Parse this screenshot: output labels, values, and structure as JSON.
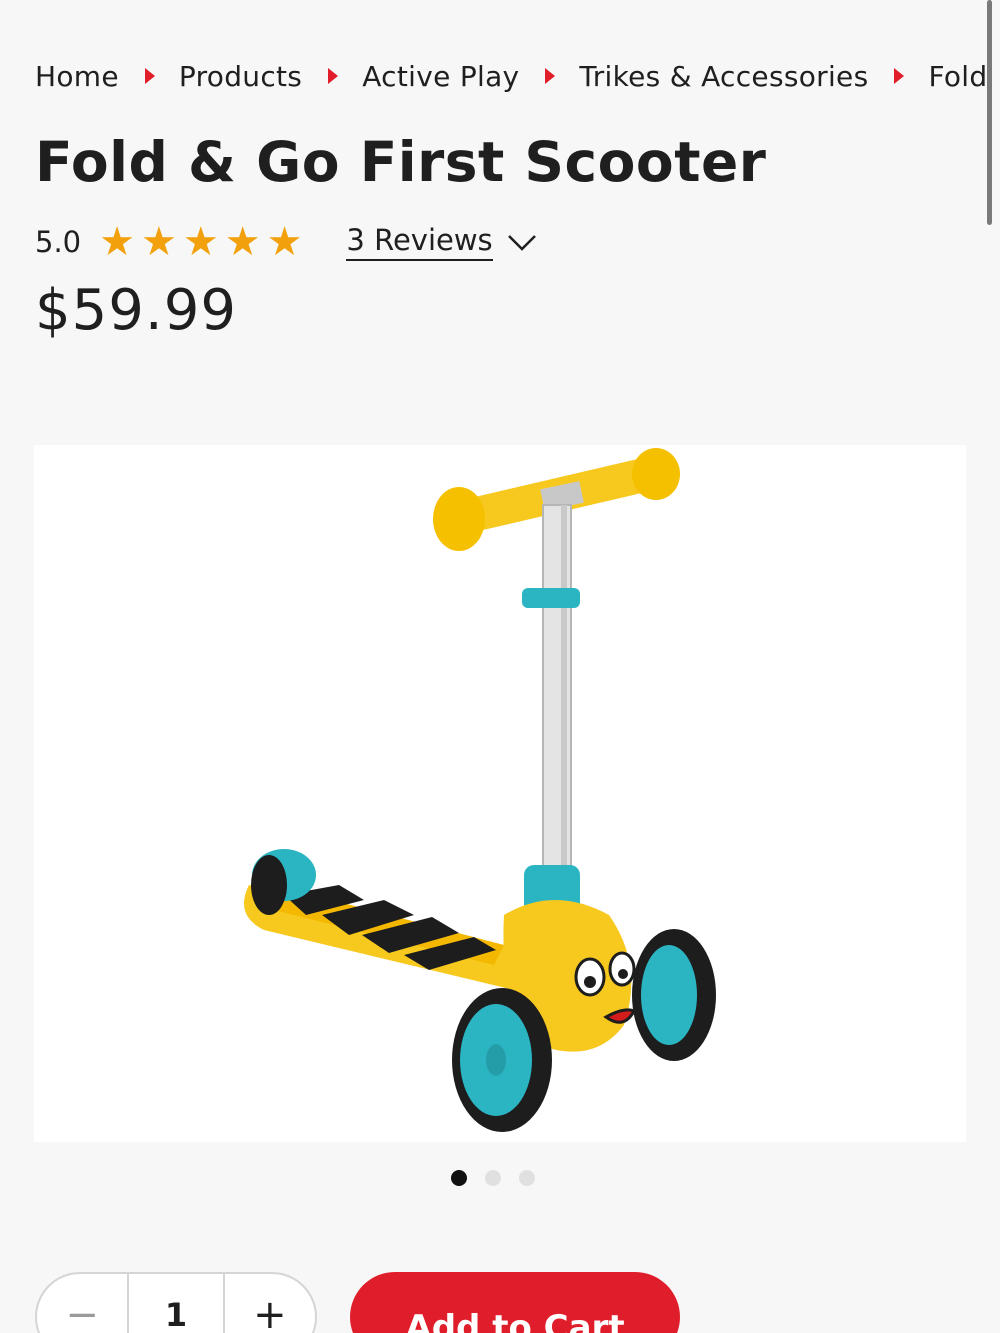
{
  "breadcrumb": [
    "Home",
    "Products",
    "Active Play",
    "Trikes & Accessories",
    "Fold"
  ],
  "product": {
    "title": "Fold & Go First Scooter",
    "rating": "5.0",
    "rating_value": 5,
    "rating_max": 5,
    "reviews_label": "3 Reviews",
    "price": "$59.99"
  },
  "gallery": {
    "count": 3,
    "active_index": 0
  },
  "purchase": {
    "quantity": "1",
    "minus_label": "−",
    "plus_label": "+",
    "add_to_cart_label": "Add to Cart"
  },
  "colors": {
    "accent_red": "#e01e2b",
    "star": "#f2a10c",
    "scooter_yellow": "#f7c91e",
    "scooter_teal": "#2bb5c3"
  },
  "icons": {
    "separator": "caret-right-icon",
    "reviews_toggle": "chevron-down-icon",
    "star": "star-icon"
  }
}
